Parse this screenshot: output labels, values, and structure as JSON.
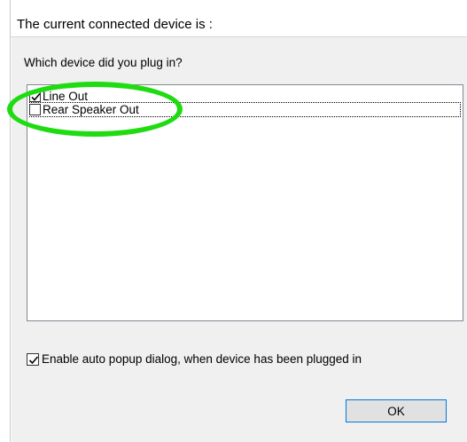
{
  "header": {
    "title": "The current connected device is :"
  },
  "prompt": {
    "question": "Which device did you plug in?"
  },
  "device_list": {
    "items": [
      {
        "label": "Line Out",
        "checked": true
      },
      {
        "label": "Rear Speaker Out",
        "checked": false
      }
    ]
  },
  "auto_popup": {
    "label": "Enable auto popup dialog, when device has been plugged in",
    "checked": true
  },
  "buttons": {
    "ok_label": "OK"
  },
  "colors": {
    "annotation": "#1fdc12",
    "focus_border": "#0078d7",
    "panel_bg": "#f0f0f0"
  }
}
